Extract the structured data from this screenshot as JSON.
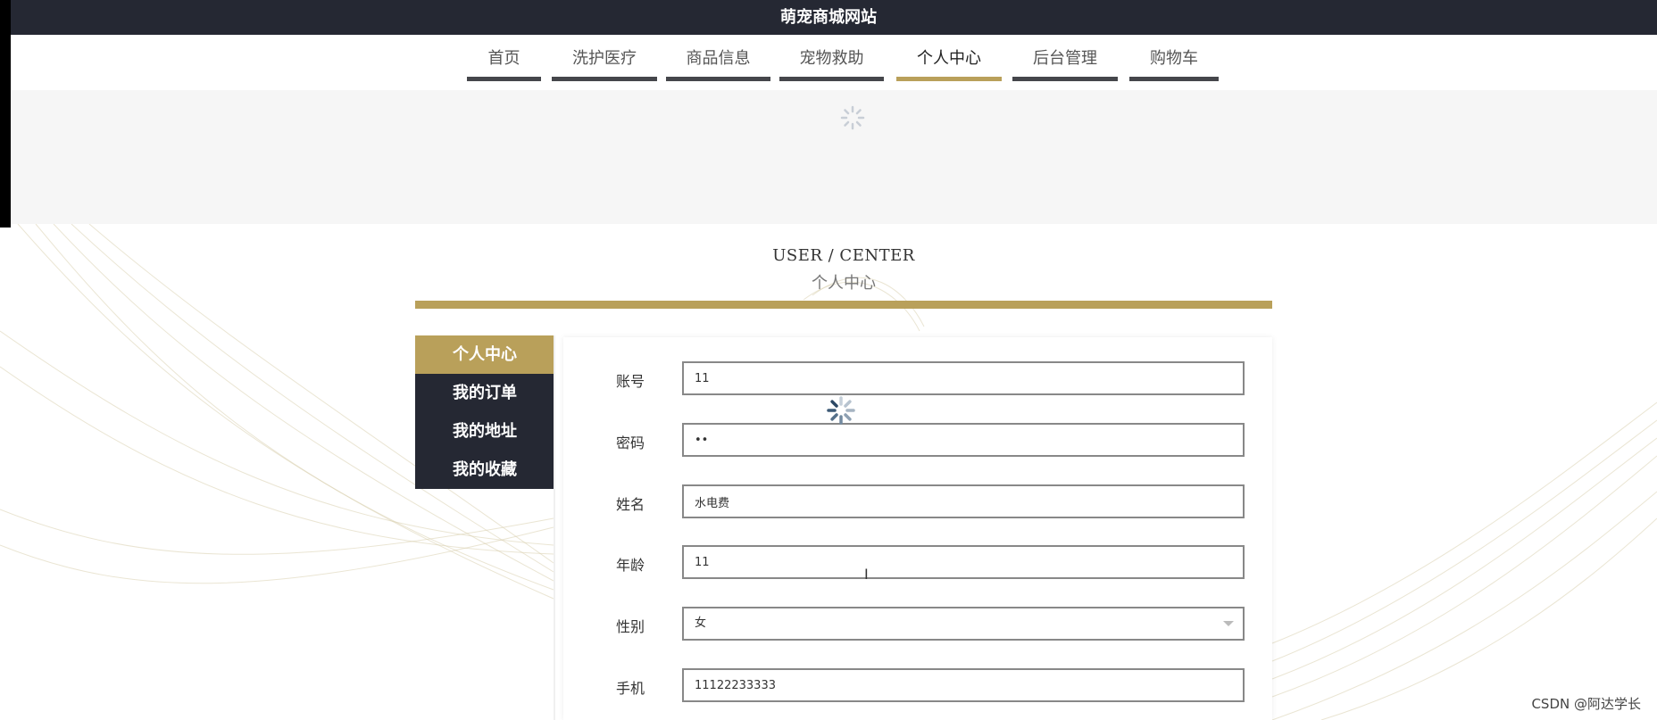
{
  "site": {
    "title": "萌宠商城网站"
  },
  "nav": {
    "items": [
      {
        "label": "首页",
        "active": false
      },
      {
        "label": "洗护医疗",
        "active": false
      },
      {
        "label": "商品信息",
        "active": false
      },
      {
        "label": "宠物救助",
        "active": false
      },
      {
        "label": "个人中心",
        "active": true
      },
      {
        "label": "后台管理",
        "active": false
      },
      {
        "label": "购物车",
        "active": false
      }
    ]
  },
  "section": {
    "title_en": "USER / CENTER",
    "title_cn": "个人中心"
  },
  "side_menu": {
    "items": [
      {
        "label": "个人中心",
        "active": true
      },
      {
        "label": "我的订单",
        "active": false
      },
      {
        "label": "我的地址",
        "active": false
      },
      {
        "label": "我的收藏",
        "active": false
      }
    ]
  },
  "form": {
    "account": {
      "label": "账号",
      "value": "11"
    },
    "password": {
      "label": "密码",
      "value": "••"
    },
    "name": {
      "label": "姓名",
      "value": "水电费"
    },
    "age": {
      "label": "年龄",
      "value": "11"
    },
    "gender": {
      "label": "性别",
      "value": "女"
    },
    "phone": {
      "label": "手机",
      "value": "11122233333"
    }
  },
  "watermark": "CSDN @阿达学长",
  "colors": {
    "dark": "#252833",
    "gold": "#b9a05a"
  },
  "icons": {
    "loading": "spinner-icon",
    "caret": "caret-down-icon"
  }
}
